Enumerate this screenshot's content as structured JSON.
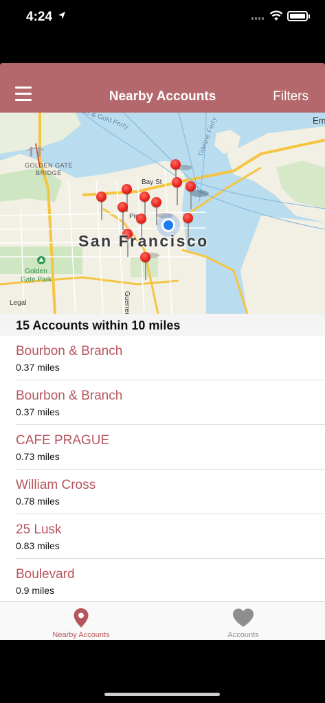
{
  "status_bar": {
    "time": "4:24"
  },
  "navbar": {
    "title": "Nearby Accounts",
    "filters_label": "Filters"
  },
  "map": {
    "city_label": "San Francisco",
    "golden_gate_label": "GOLDEN GATE\nBRIDGE",
    "park_label": "Golden\nGate Park",
    "street_bay": "Bay St",
    "street_pine": "Pine",
    "street_guerrero": "Guerrero St",
    "ferry_label": "ue & Gold Ferry",
    "ferry2_label": "Tideline Ferry",
    "edge_label": "Em",
    "legal": "Legal"
  },
  "list": {
    "header": "15 Accounts within 10 miles",
    "items": [
      {
        "name": "Bourbon & Branch",
        "distance": "0.37 miles"
      },
      {
        "name": "Bourbon & Branch",
        "distance": "0.37 miles"
      },
      {
        "name": "CAFE PRAGUE",
        "distance": "0.73 miles"
      },
      {
        "name": "William Cross",
        "distance": "0.78 miles"
      },
      {
        "name": "25 Lusk",
        "distance": "0.83 miles"
      },
      {
        "name": "Boulevard",
        "distance": "0.9 miles"
      }
    ]
  },
  "tabbar": {
    "tab1_label": "Nearby Accounts",
    "tab1_icon": "map-pin-icon",
    "tab2_label": "Accounts",
    "tab2_icon": "heart-icon"
  },
  "colors": {
    "accent": "#b5686c",
    "link": "#b5555c"
  }
}
